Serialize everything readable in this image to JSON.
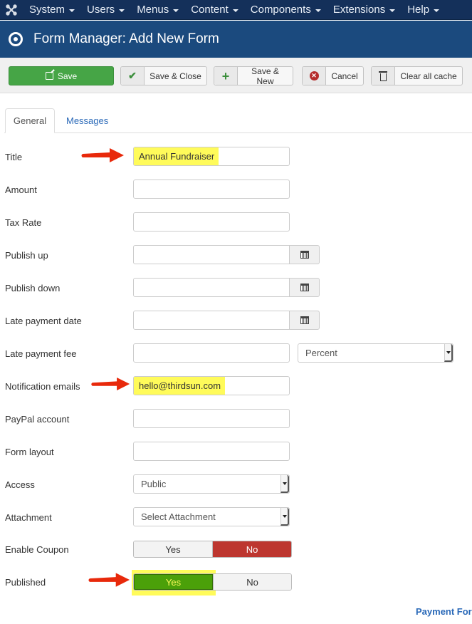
{
  "topnav": {
    "logo_icon": "joomla-logo-icon",
    "items": [
      {
        "label": "System"
      },
      {
        "label": "Users"
      },
      {
        "label": "Menus"
      },
      {
        "label": "Content"
      },
      {
        "label": "Components"
      },
      {
        "label": "Extensions"
      },
      {
        "label": "Help"
      }
    ]
  },
  "header": {
    "icon": "target-circle-icon",
    "title": "Form Manager: Add New Form"
  },
  "toolbar": {
    "save_label": "Save",
    "save_close_label": "Save & Close",
    "save_new_label": "Save & New",
    "cancel_label": "Cancel",
    "clear_cache_label": "Clear all cache",
    "colors": {
      "save_bg": "#46a546",
      "cancel_icon": "#b52d2d"
    }
  },
  "tabs": [
    {
      "label": "General",
      "active": true
    },
    {
      "label": "Messages",
      "active": false
    }
  ],
  "form": {
    "title": {
      "label": "Title",
      "value": "Annual Fundraiser"
    },
    "amount": {
      "label": "Amount",
      "value": ""
    },
    "tax_rate": {
      "label": "Tax Rate",
      "value": ""
    },
    "publish_up": {
      "label": "Publish up",
      "value": ""
    },
    "publish_down": {
      "label": "Publish down",
      "value": ""
    },
    "late_payment_date": {
      "label": "Late payment date",
      "value": ""
    },
    "late_payment_fee": {
      "label": "Late payment fee",
      "value": "",
      "type_selected": "Percent"
    },
    "notification_emails": {
      "label": "Notification emails",
      "value": "hello@thirdsun.com"
    },
    "paypal_account": {
      "label": "PayPal account",
      "value": ""
    },
    "form_layout": {
      "label": "Form layout",
      "value": ""
    },
    "access": {
      "label": "Access",
      "selected": "Public"
    },
    "attachment": {
      "label": "Attachment",
      "selected": "Select Attachment"
    },
    "enable_coupon": {
      "label": "Enable Coupon",
      "yes": "Yes",
      "no": "No",
      "value": "No"
    },
    "published": {
      "label": "Published",
      "yes": "Yes",
      "no": "No",
      "value": "Yes"
    }
  },
  "footer": {
    "link_text": "Payment For"
  },
  "annotations": {
    "highlight_color": "#fffb5a",
    "arrow_color": "#e8290b"
  }
}
